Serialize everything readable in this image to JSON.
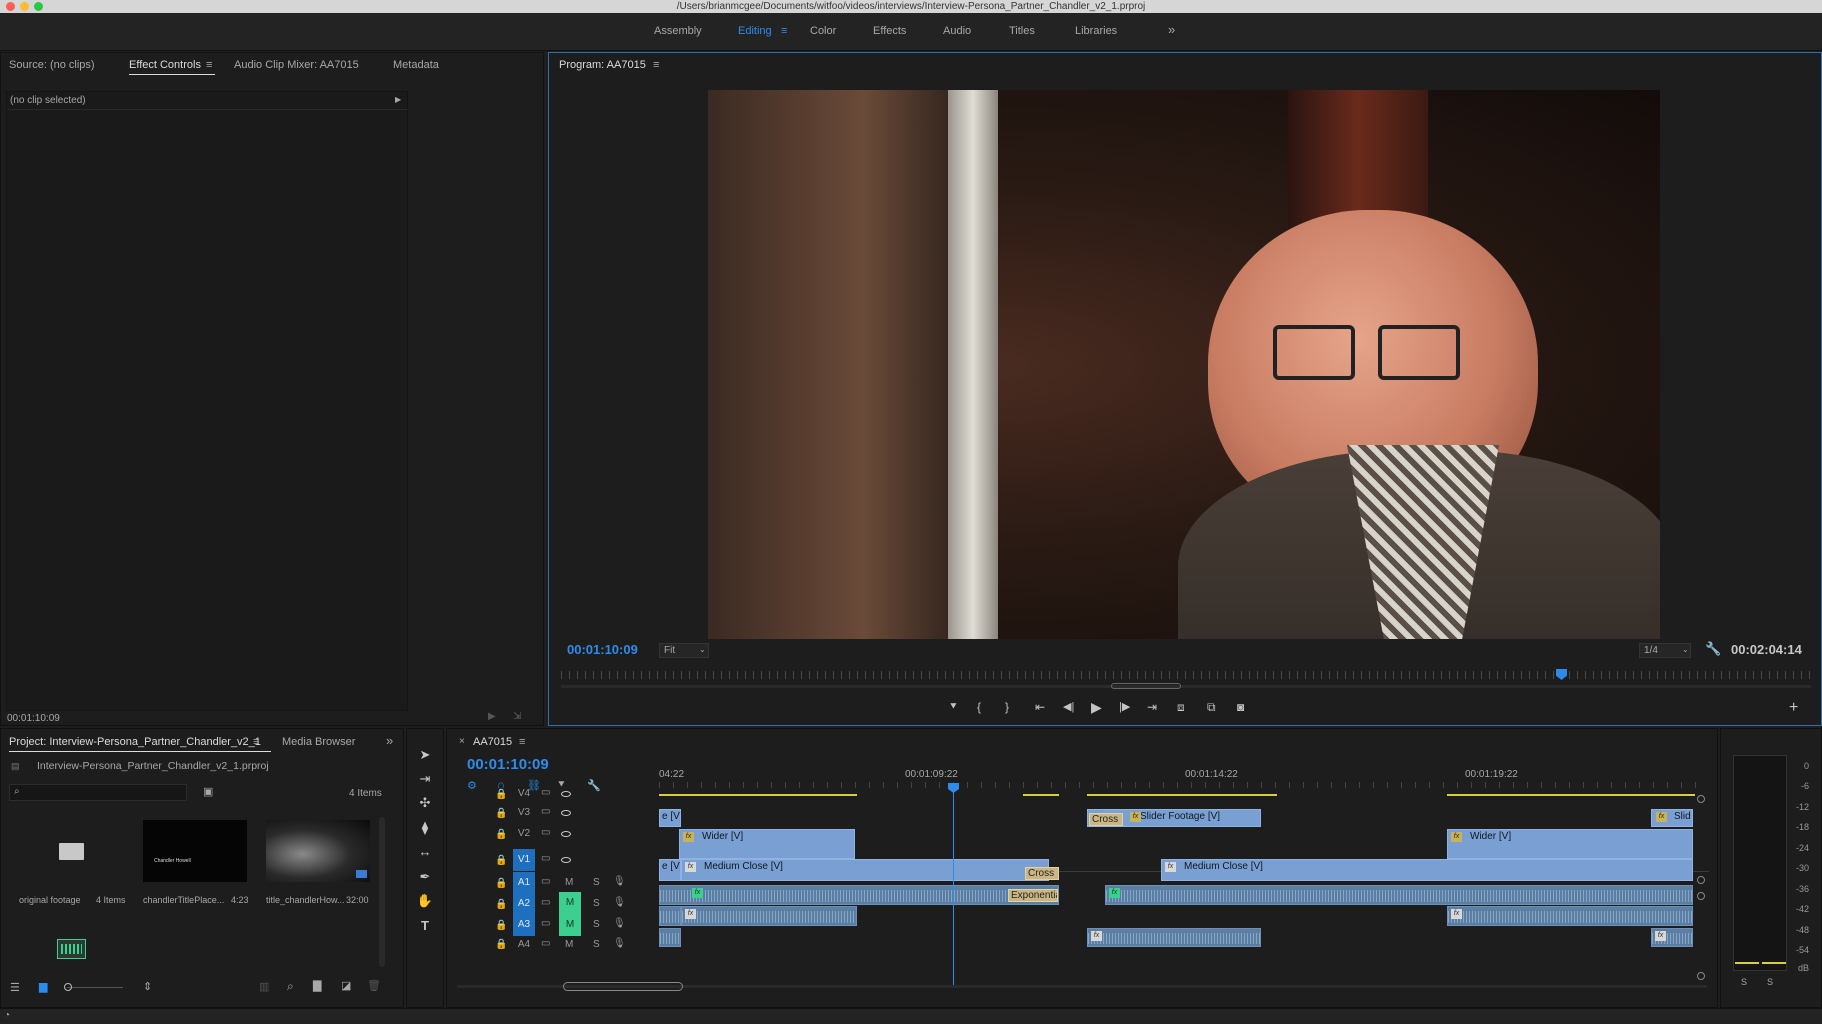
{
  "window": {
    "title": "/Users/brianmcgee/Documents/witfoo/videos/interviews/Interview-Persona_Partner_Chandler_v2_1.prproj"
  },
  "workspaces": [
    "Assembly",
    "Editing",
    "Color",
    "Effects",
    "Audio",
    "Titles",
    "Libraries"
  ],
  "active_workspace": "Editing",
  "source_panel": {
    "tabs": [
      "Source: (no clips)",
      "Effect Controls",
      "Audio Clip Mixer: AA7015",
      "Metadata"
    ],
    "active_tab": "Effect Controls",
    "no_clip_text": "(no clip selected)",
    "timecode": "00:01:10:09"
  },
  "program_monitor": {
    "title": "Program: AA7015",
    "timecode": "00:01:10:09",
    "fit": "Fit",
    "resolution": "1/4",
    "duration": "00:02:04:14",
    "playhead_fraction": 0.8
  },
  "project_panel": {
    "tab": "Project: Interview-Persona_Partner_Chandler_v2_1",
    "tab2": "Media Browser",
    "project_file": "Interview-Persona_Partner_Chandler_v2_1.prproj",
    "item_count": "4 Items",
    "items": [
      {
        "name": "original footage",
        "meta": "4 Items",
        "icon": "folder-icon"
      },
      {
        "name": "chandlerTitlePlace...",
        "meta": "4:23",
        "thumb_text": "Chandler Howell"
      },
      {
        "name": "title_chandlerHow...",
        "meta": "32:00"
      }
    ]
  },
  "timeline": {
    "sequence": "AA7015",
    "timecode": "00:01:10:09",
    "ruler": [
      "04:22",
      "00:01:09:22",
      "00:01:14:22",
      "00:01:19:22"
    ],
    "video_tracks": [
      "V4",
      "V3",
      "V2",
      "V1"
    ],
    "audio_tracks": [
      "A1",
      "A2",
      "A3",
      "A4"
    ],
    "clips": {
      "v3_slider": "Slider Footage [V]",
      "v3_cross": "Cross",
      "v3_end": "Slid",
      "v2_wider_a": "Wider [V]",
      "v2_wider_b": "Wider [V]",
      "v1_head_a": "e [V]",
      "v3_head": "e [V]",
      "v1_medium_a": "Medium Close [V]",
      "v1_cross": "Cross",
      "v1_medium_b": "Medium Close [V]",
      "a1_exp": "Exponentia"
    },
    "track_m": "M",
    "track_s": "S"
  },
  "audio_meter": {
    "labels": [
      "0",
      "-6",
      "-12",
      "-18",
      "-24",
      "-30",
      "-36",
      "-42",
      "-48",
      "-54",
      "dB"
    ],
    "solo": [
      "S",
      "S"
    ]
  },
  "colors": {
    "accent": "#2d8ceb",
    "video_clip": "#7a9fd2",
    "audio_clip": "#5c7ea3",
    "active_track": "#1f6fbf",
    "mute_green": "#3ccf8e"
  }
}
